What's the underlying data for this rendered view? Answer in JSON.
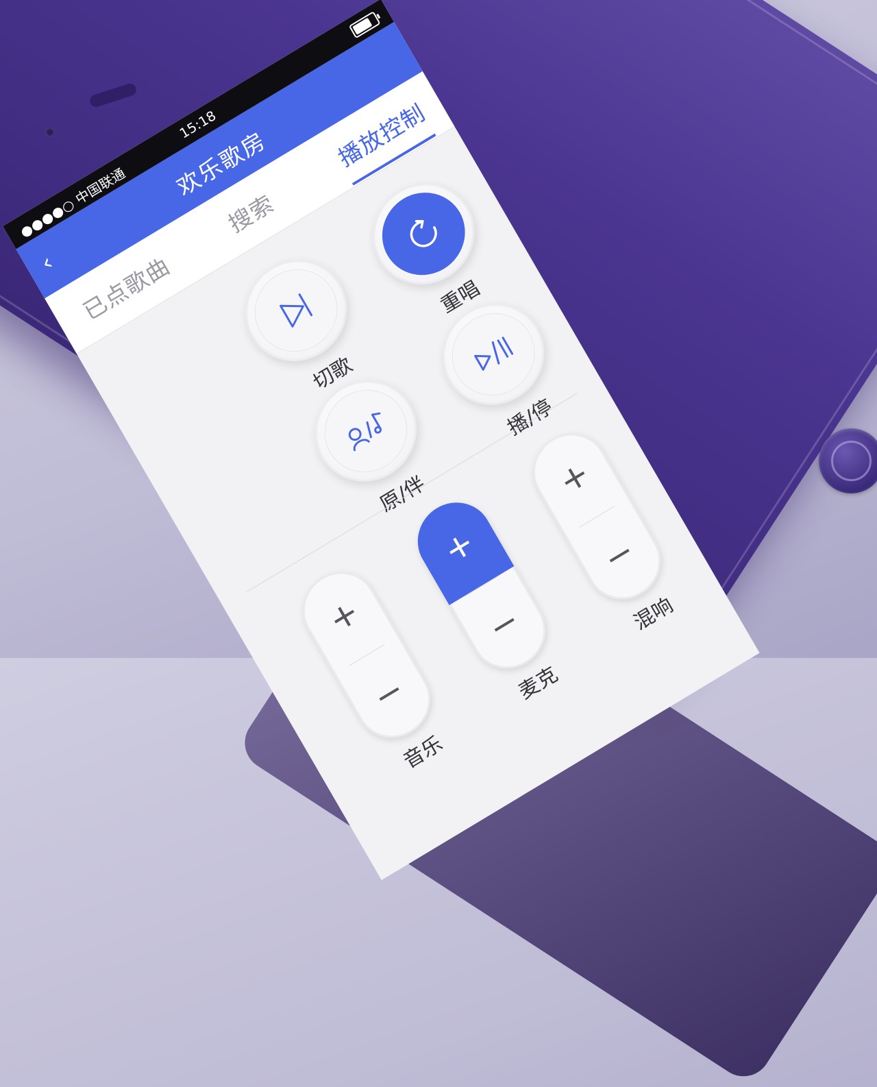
{
  "status_bar": {
    "carrier": "●●●●○ 中国联通",
    "time": "15:18"
  },
  "app_bar": {
    "back_icon": "chevron-left-icon",
    "title": "欢乐歌房"
  },
  "tabs": [
    {
      "label": "已点歌曲",
      "active": false
    },
    {
      "label": "搜索",
      "active": false
    },
    {
      "label": "播放控制",
      "active": true
    }
  ],
  "controls": {
    "replay": {
      "label": "重唱",
      "icon": "replay-icon"
    },
    "skip": {
      "label": "切歌",
      "icon": "skip-icon"
    },
    "play_pause": {
      "label": "播/停",
      "icon": "play-pause-icon"
    },
    "vocal": {
      "label": "原/伴",
      "icon": "vocal-toggle-icon"
    }
  },
  "steppers": [
    {
      "label": "混响",
      "plus": "+",
      "minus": "−",
      "active": false
    },
    {
      "label": "麦克",
      "plus": "+",
      "minus": "−",
      "active": true
    },
    {
      "label": "音乐",
      "plus": "+",
      "minus": "−",
      "active": false
    }
  ],
  "colors": {
    "accent": "#4867e6",
    "phone": "#4a3590"
  }
}
